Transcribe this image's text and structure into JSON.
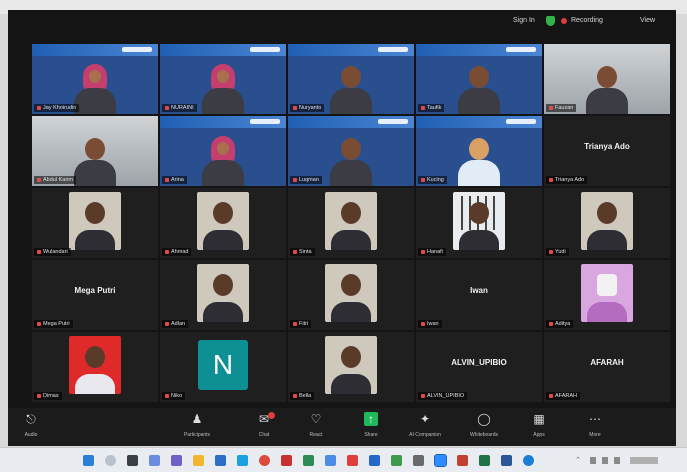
{
  "window": {
    "top_bar": {
      "sign_in": "Sign In",
      "recording": "Recording",
      "view": "View"
    },
    "tiles": [
      {
        "label": "Jay Khoirudin",
        "kind": "video",
        "person": "hijab-blue"
      },
      {
        "label": "NURAINI",
        "kind": "video",
        "person": "hijab"
      },
      {
        "label": "Nuryanto",
        "kind": "video",
        "person": "plain"
      },
      {
        "label": "Taufik",
        "kind": "video",
        "person": "plain"
      },
      {
        "label": "Fauzan",
        "kind": "room",
        "person": "plain"
      },
      {
        "label": "Abdul Karim",
        "kind": "room",
        "person": "plain"
      },
      {
        "label": "Arina",
        "kind": "video",
        "person": "hijab"
      },
      {
        "label": "Luqman",
        "kind": "video",
        "person": "plain"
      },
      {
        "label": "Kucing",
        "kind": "video",
        "person": "cat"
      },
      {
        "label": "Trianya Ado",
        "kind": "name",
        "center": "Trianya Ado"
      },
      {
        "label": "Wulandari",
        "kind": "photo"
      },
      {
        "label": "Ahmad",
        "kind": "photo"
      },
      {
        "label": "Sinta",
        "kind": "photo"
      },
      {
        "label": "Hanafi",
        "kind": "photo-window"
      },
      {
        "label": "Yudi",
        "kind": "photo"
      },
      {
        "label": "Mega Putri",
        "kind": "name",
        "center": "Mega Putri"
      },
      {
        "label": "Adlan",
        "kind": "photo"
      },
      {
        "label": "Fitri",
        "kind": "photo"
      },
      {
        "label": "Iwan",
        "kind": "name",
        "center": "Iwan"
      },
      {
        "label": "Aditya",
        "kind": "photo-pink"
      },
      {
        "label": "Dimas",
        "kind": "photo-red"
      },
      {
        "label": "Niko",
        "kind": "avatar",
        "letter": "N"
      },
      {
        "label": "Bella",
        "kind": "photo"
      },
      {
        "label": "ALVIN_UPIBIO",
        "kind": "name",
        "center": "ALVIN_UPIBIO"
      },
      {
        "label": "AFARAH",
        "kind": "name",
        "center": "AFARAH"
      }
    ],
    "controls": {
      "audio": "Audio",
      "participants": "Participants",
      "chat": "Chat",
      "react": "React",
      "share": "Share",
      "ai": "AI Companion",
      "whiteboards": "Whiteboards",
      "apps": "Apps",
      "more": "More"
    }
  },
  "icons": {
    "audio": "mic-icon",
    "participants": "people-icon",
    "chat": "chat-icon",
    "react": "heart-icon",
    "share": "share-screen-icon",
    "ai": "sparkle-icon",
    "whiteboards": "whiteboard-icon",
    "apps": "apps-icon",
    "more": "more-icon"
  }
}
